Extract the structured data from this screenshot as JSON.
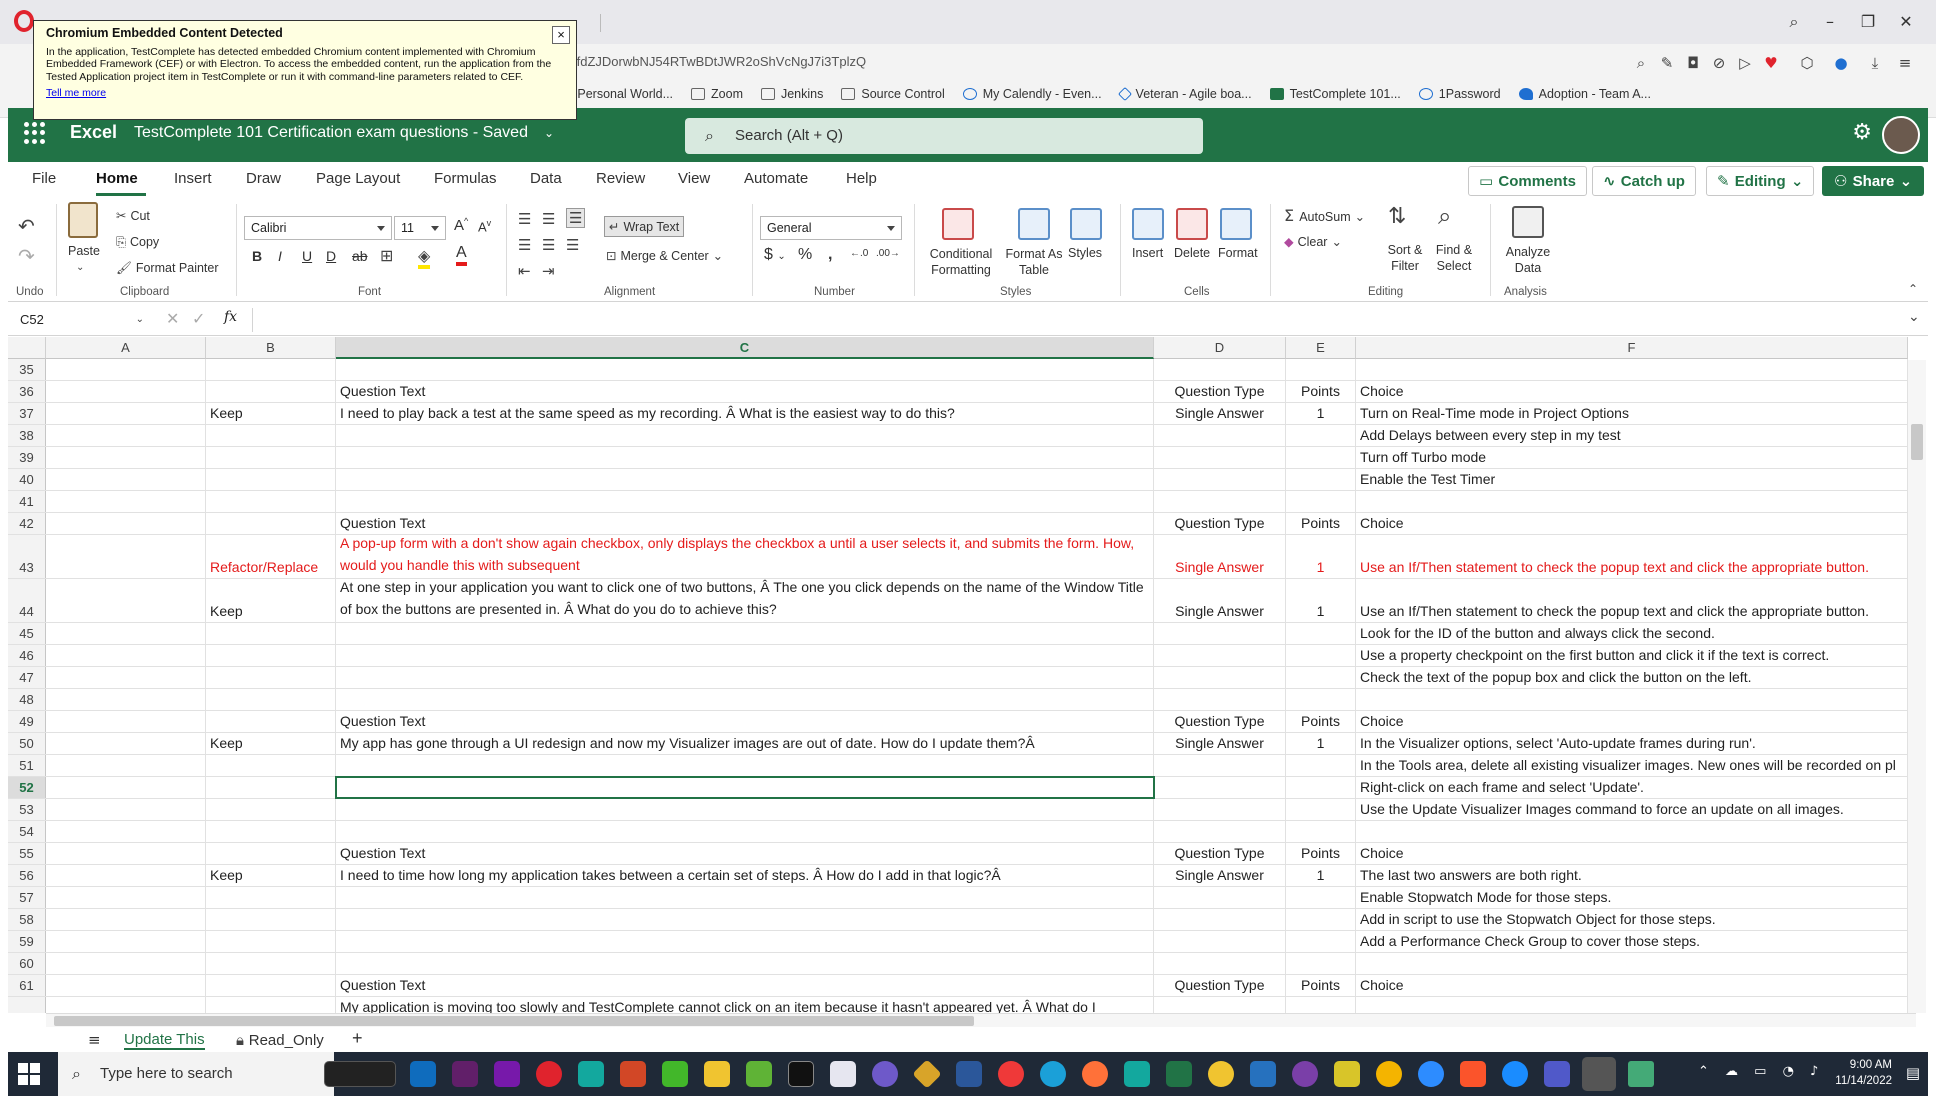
{
  "browser": {
    "address": "cdifdZJDorwbNJ54RTwBDtJWR2oShVcNgJ7i3TplzQ",
    "bookmarks": [
      "he Personal World...",
      "Zoom",
      "Jenkins",
      "Source Control",
      "My Calendly - Even...",
      "Veteran - Agile boa...",
      "TestComplete 101...",
      "1Password",
      "Adoption - Team A..."
    ]
  },
  "notification": {
    "title": "Chromium Embedded Content Detected",
    "body": "In the application, TestComplete has detected embedded Chromium content implemented with Chromium Embedded Framework (CEF) or with Electron. To access the embedded content, run the application from the Tested Application project item in TestComplete or run it with command-line parameters related to CEF.",
    "link": "Tell me more",
    "close": "×"
  },
  "excel": {
    "brand": "Excel",
    "title": "TestComplete 101 Certification exam questions  -  Saved",
    "search_placeholder": "Search (Alt + Q)"
  },
  "menu": {
    "items": [
      "File",
      "Home",
      "Insert",
      "Draw",
      "Page Layout",
      "Formulas",
      "Data",
      "Review",
      "View",
      "Automate",
      "Help"
    ],
    "comments": "Comments",
    "catchup": "Catch up",
    "editing": "Editing",
    "share": "Share"
  },
  "ribbon": {
    "undo_group": "Undo",
    "paste": "Paste",
    "cut": "Cut",
    "copy": "Copy",
    "format_painter": "Format Painter",
    "clipboard_group": "Clipboard",
    "font_name": "Calibri",
    "font_size": "11",
    "font_group": "Font",
    "wrap_text": "Wrap Text",
    "merge_center": "Merge & Center",
    "alignment_group": "Alignment",
    "number_format": "General",
    "number_group": "Number",
    "conditional_formatting": "Conditional Formatting",
    "format_as_table": "Format As Table",
    "styles": "Styles",
    "styles_group": "Styles",
    "insert": "Insert",
    "delete": "Delete",
    "format": "Format",
    "cells_group": "Cells",
    "autosum": "AutoSum",
    "clear": "Clear",
    "sort_filter": "Sort & Filter",
    "find_select": "Find & Select",
    "editing_group": "Editing",
    "analyze_data": "Analyze Data",
    "analysis_group": "Analysis"
  },
  "formula_bar": {
    "name_box": "C52",
    "fx": "fx"
  },
  "columns": [
    "A",
    "B",
    "C",
    "D",
    "E",
    "F"
  ],
  "rows": [
    {
      "n": "35",
      "b": "",
      "c": "",
      "d": "",
      "e": "",
      "f": ""
    },
    {
      "n": "36",
      "b": "",
      "c": "Question Text",
      "d": "Question Type",
      "e": "Points",
      "f": "Choice"
    },
    {
      "n": "37",
      "b": "Keep",
      "c": "I need to play back a test at the same speed as my recording. Â What is the easiest way to do this?",
      "d": "Single Answer",
      "e": "1",
      "f": "Turn on Real-Time mode in Project Options"
    },
    {
      "n": "38",
      "b": "",
      "c": "",
      "d": "",
      "e": "",
      "f": "Add Delays between every step in my test"
    },
    {
      "n": "39",
      "b": "",
      "c": "",
      "d": "",
      "e": "",
      "f": "Turn off Turbo mode"
    },
    {
      "n": "40",
      "b": "",
      "c": "",
      "d": "",
      "e": "",
      "f": "Enable the Test Timer"
    },
    {
      "n": "41",
      "b": "",
      "c": "",
      "d": "",
      "e": "",
      "f": ""
    },
    {
      "n": "42",
      "b": "",
      "c": "Question Text",
      "d": "Question Type",
      "e": "Points",
      "f": "Choice"
    },
    {
      "n": "43",
      "b": "Refactor/Replace",
      "c": "A pop-up form with a don't show again checkbox, only displays the checkbox a until a user selects it, and submits the form. How, would you handle this with subsequent",
      "d": "Single Answer",
      "e": "1",
      "f": "Use an If/Then statement to check the popup text and click the appropriate button.",
      "red": true,
      "tall": true
    },
    {
      "n": "44",
      "b": "Keep",
      "c": "At one step in your application you want to click one of two buttons, Â The one you click depends on the name of the Window Title of box the buttons are presented in. Â What do you do to achieve this?",
      "d": "Single Answer",
      "e": "1",
      "f": "Use an If/Then statement to check the popup text and click the appropriate button.",
      "tall": true
    },
    {
      "n": "45",
      "b": "",
      "c": "",
      "d": "",
      "e": "",
      "f": "Look for the ID of the button and always click the second."
    },
    {
      "n": "46",
      "b": "",
      "c": "",
      "d": "",
      "e": "",
      "f": "Use a property checkpoint on the first button and click it if the text is correct."
    },
    {
      "n": "47",
      "b": "",
      "c": "",
      "d": "",
      "e": "",
      "f": "Check the text of the popup box and click the button on the left."
    },
    {
      "n": "48",
      "b": "",
      "c": "",
      "d": "",
      "e": "",
      "f": ""
    },
    {
      "n": "49",
      "b": "",
      "c": "Question Text",
      "d": "Question Type",
      "e": "Points",
      "f": "Choice"
    },
    {
      "n": "50",
      "b": "Keep",
      "c": "My app has gone through a UI redesign and now my Visualizer images are out of date. How do I update them?Â",
      "d": "Single Answer",
      "e": "1",
      "f": "In the Visualizer options, select 'Auto-update frames during run'."
    },
    {
      "n": "51",
      "b": "",
      "c": "",
      "d": "",
      "e": "",
      "f": "In the Tools area, delete all existing visualizer images. New ones will be recorded on pl"
    },
    {
      "n": "52",
      "b": "",
      "c": "",
      "d": "",
      "e": "",
      "f": "Right-click on each frame and select 'Update'.",
      "selected": true
    },
    {
      "n": "53",
      "b": "",
      "c": "",
      "d": "",
      "e": "",
      "f": "Use the Update Visualizer Images command to force an update on all images."
    },
    {
      "n": "54",
      "b": "",
      "c": "",
      "d": "",
      "e": "",
      "f": ""
    },
    {
      "n": "55",
      "b": "",
      "c": "Question Text",
      "d": "Question Type",
      "e": "Points",
      "f": "Choice"
    },
    {
      "n": "56",
      "b": "Keep",
      "c": "I need to time how long my application takes between a certain set of steps. Â How do I add in that logic?Â",
      "d": "Single Answer",
      "e": "1",
      "f": "The last two answers are both right."
    },
    {
      "n": "57",
      "b": "",
      "c": "",
      "d": "",
      "e": "",
      "f": "Enable Stopwatch Mode for those steps."
    },
    {
      "n": "58",
      "b": "",
      "c": "",
      "d": "",
      "e": "",
      "f": "Add in script to use the Stopwatch Object for those steps."
    },
    {
      "n": "59",
      "b": "",
      "c": "",
      "d": "",
      "e": "",
      "f": "Add a Performance Check Group to cover those steps."
    },
    {
      "n": "60",
      "b": "",
      "c": "",
      "d": "",
      "e": "",
      "f": ""
    },
    {
      "n": "61",
      "b": "",
      "c": "Question Text",
      "d": "Question Type",
      "e": "Points",
      "f": "Choice"
    },
    {
      "n": "",
      "b": "",
      "c": "My application is moving too slowly and TestComplete cannot click on an item because it hasn't appeared yet. Â What do I",
      "d": "",
      "e": "",
      "f": ""
    }
  ],
  "sheets": {
    "active": "Update This",
    "other": "Read_Only",
    "add": "+"
  },
  "taskbar": {
    "search": "Type here to search",
    "time": "9:00 AM",
    "date": "11/14/2022"
  },
  "colors": {
    "excel_green": "#217346",
    "red_text": "#e41b1b"
  }
}
